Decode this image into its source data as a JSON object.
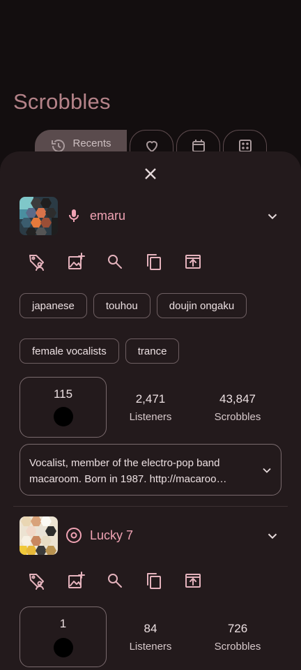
{
  "page": {
    "title": "Scrobbles"
  },
  "tabs": [
    {
      "label": "Recents",
      "icon": "history-icon"
    },
    {
      "label": "",
      "icon": "heart-icon"
    },
    {
      "label": "",
      "icon": "calendar-icon"
    },
    {
      "label": "",
      "icon": "dice-icon"
    }
  ],
  "sheet": {
    "close_icon": "close-icon",
    "items": [
      {
        "type_icon": "microphone-icon",
        "name": "emaru",
        "actions": [
          "tag-user-icon",
          "add-image-icon",
          "search-icon",
          "copy-icon",
          "share-icon"
        ],
        "tags": [
          "japanese",
          "touhou",
          "doujin ongaku",
          "female vocalists",
          "trance"
        ],
        "user_count": "115",
        "listeners_value": "2,471",
        "listeners_label": "Listeners",
        "scrobbles_value": "43,847",
        "scrobbles_label": "Scrobbles",
        "bio_line1": "Vocalist, member of the electro-pop band",
        "bio_line2": "macaroom. Born in 1987. http://macaroo…"
      },
      {
        "type_icon": "album-icon",
        "name": "Lucky 7",
        "actions": [
          "tag-user-icon",
          "add-image-icon",
          "search-icon",
          "copy-icon",
          "share-icon"
        ],
        "user_count": "1",
        "listeners_value": "84",
        "listeners_label": "Listeners",
        "scrobbles_value": "726",
        "scrobbles_label": "Scrobbles"
      }
    ]
  },
  "colors": {
    "accent": "#f0a3b4",
    "title": "#b58389",
    "sheet_bg": "#231a1c",
    "screen_bg": "#130e0f"
  }
}
